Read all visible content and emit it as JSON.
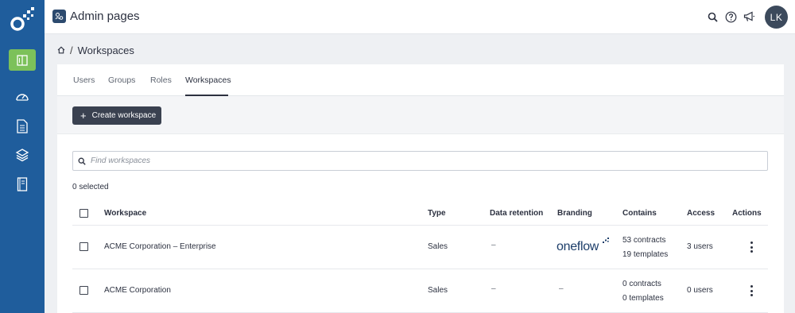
{
  "app": {
    "title": "Admin pages"
  },
  "user": {
    "initials": "LK"
  },
  "breadcrumb": {
    "current": "Workspaces"
  },
  "tabs": [
    {
      "label": "Users"
    },
    {
      "label": "Groups"
    },
    {
      "label": "Roles"
    },
    {
      "label": "Workspaces",
      "active": true
    }
  ],
  "toolbar": {
    "create_label": "Create workspace",
    "create_icon": "plus-icon"
  },
  "search": {
    "placeholder": "Find workspaces",
    "value": ""
  },
  "selection": {
    "count_label": "0 selected"
  },
  "table": {
    "headers": {
      "workspace": "Workspace",
      "type": "Type",
      "data_retention": "Data retention",
      "branding": "Branding",
      "contains": "Contains",
      "access": "Access",
      "actions": "Actions"
    },
    "rows": [
      {
        "workspace": "ACME Corporation – Enterprise",
        "type": "Sales",
        "data_retention": "–",
        "branding": "oneflow",
        "contracts": "53 contracts",
        "templates": "19 templates",
        "access": "3 users"
      },
      {
        "workspace": "ACME Corporation",
        "type": "Sales",
        "data_retention": "–",
        "branding": "–",
        "contracts": "0 contracts",
        "templates": "0 templates",
        "access": "0 users"
      }
    ]
  },
  "colors": {
    "sidebar": "#1f5d9c",
    "active_nav": "#7cc15a",
    "primary_button": "#3a4150",
    "brand_text": "#1d3e6a"
  },
  "icons": {
    "sidebar": [
      "oneflow-logo-icon",
      "admin-pages-icon",
      "dashboard-gauge-icon",
      "documents-icon",
      "templates-layers-icon",
      "address-book-icon"
    ],
    "topbar": [
      "search-icon",
      "help-icon",
      "announcement-megaphone-icon"
    ]
  }
}
